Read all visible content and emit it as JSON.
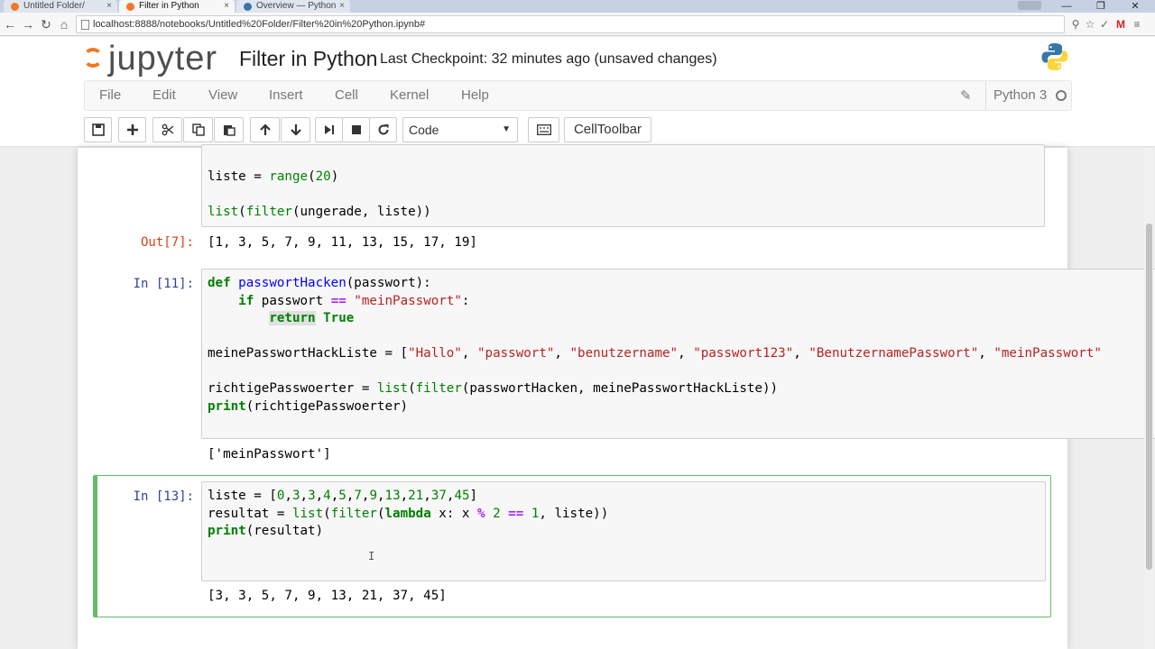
{
  "browser": {
    "tabs": [
      {
        "label": "Untitled Folder/",
        "close": "×"
      },
      {
        "label": "Filter in Python",
        "close": "×"
      },
      {
        "label": "Overview — Python",
        "close": "×"
      }
    ],
    "url": "localhost:8888/notebooks/Untitled%20Folder/Filter%20in%20Python.ipynb#",
    "window_controls": {
      "minimize": "—",
      "restore": "❐",
      "close": "✕"
    },
    "nav": {
      "back": "←",
      "forward": "→",
      "reload": "↻",
      "home": "⌂"
    }
  },
  "header": {
    "logo_text": "jupyter",
    "notebook_title": "Filter in Python",
    "checkpoint": "Last Checkpoint: 32 minutes ago (unsaved changes)"
  },
  "menubar": {
    "items": [
      "File",
      "Edit",
      "View",
      "Insert",
      "Cell",
      "Kernel",
      "Help"
    ],
    "kernel_name": "Python 3"
  },
  "toolbar": {
    "cell_type": "Code",
    "celltoolbar_label": "CellToolbar"
  },
  "cells": {
    "cell7": {
      "output_prompt": "Out[7]:",
      "output": "[1, 3, 5, 7, 9, 11, 13, 15, 17, 19]"
    },
    "cell11": {
      "input_prompt": "In [11]:",
      "output": "['meinPasswort']"
    },
    "cell13": {
      "input_prompt": "In [13]:",
      "output": "[3, 3, 5, 7, 9, 13, 21, 37, 45]"
    }
  },
  "colors": {
    "accent_orange": "#f37726",
    "selected_border": "#66bb6a",
    "in_prompt": "#303f9f",
    "out_prompt": "#d84315"
  },
  "icons": [
    "save-icon",
    "plus-icon",
    "scissors-icon",
    "copy-icon",
    "paste-icon",
    "arrow-up-icon",
    "arrow-down-icon",
    "step-forward-icon",
    "stop-icon",
    "restart-icon",
    "keyboard-icon",
    "pencil-icon",
    "python-logo-icon"
  ]
}
